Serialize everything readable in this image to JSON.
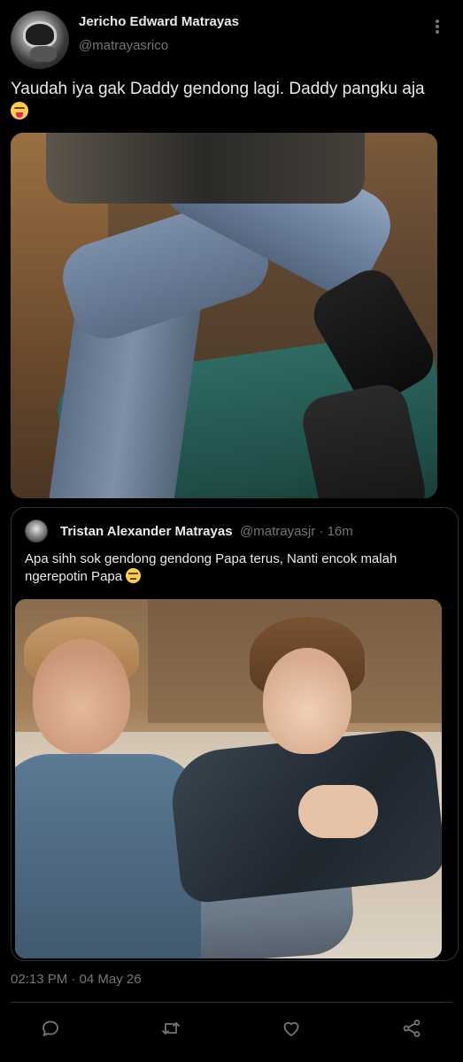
{
  "tweet": {
    "author_name": "Jericho Edward Matrayas",
    "author_handle": "@matrayasrico",
    "text": "Yaudah iya gak Daddy gendong lagi. Daddy pangku aja",
    "emoji": "squinting-face-with-tongue",
    "timestamp": "02:13 PM · 04 May 26"
  },
  "quoted": {
    "author_name": "Tristan Alexander Matrayas",
    "author_handle": "@matrayasjr",
    "time_ago": "16m",
    "meta": "@matrayasjr · 16m",
    "text": "Apa sihh sok gendong gendong Papa terus, Nanti encok malah ngerepotin Papa",
    "emoji": "unamused-face"
  },
  "actions": [
    "reply-icon",
    "retweet-icon",
    "like-icon",
    "share-icon"
  ],
  "colors": {
    "background": "#000000",
    "primary_text": "#e7e9ea",
    "secondary_text": "#71767b",
    "border": "#2f3336"
  }
}
